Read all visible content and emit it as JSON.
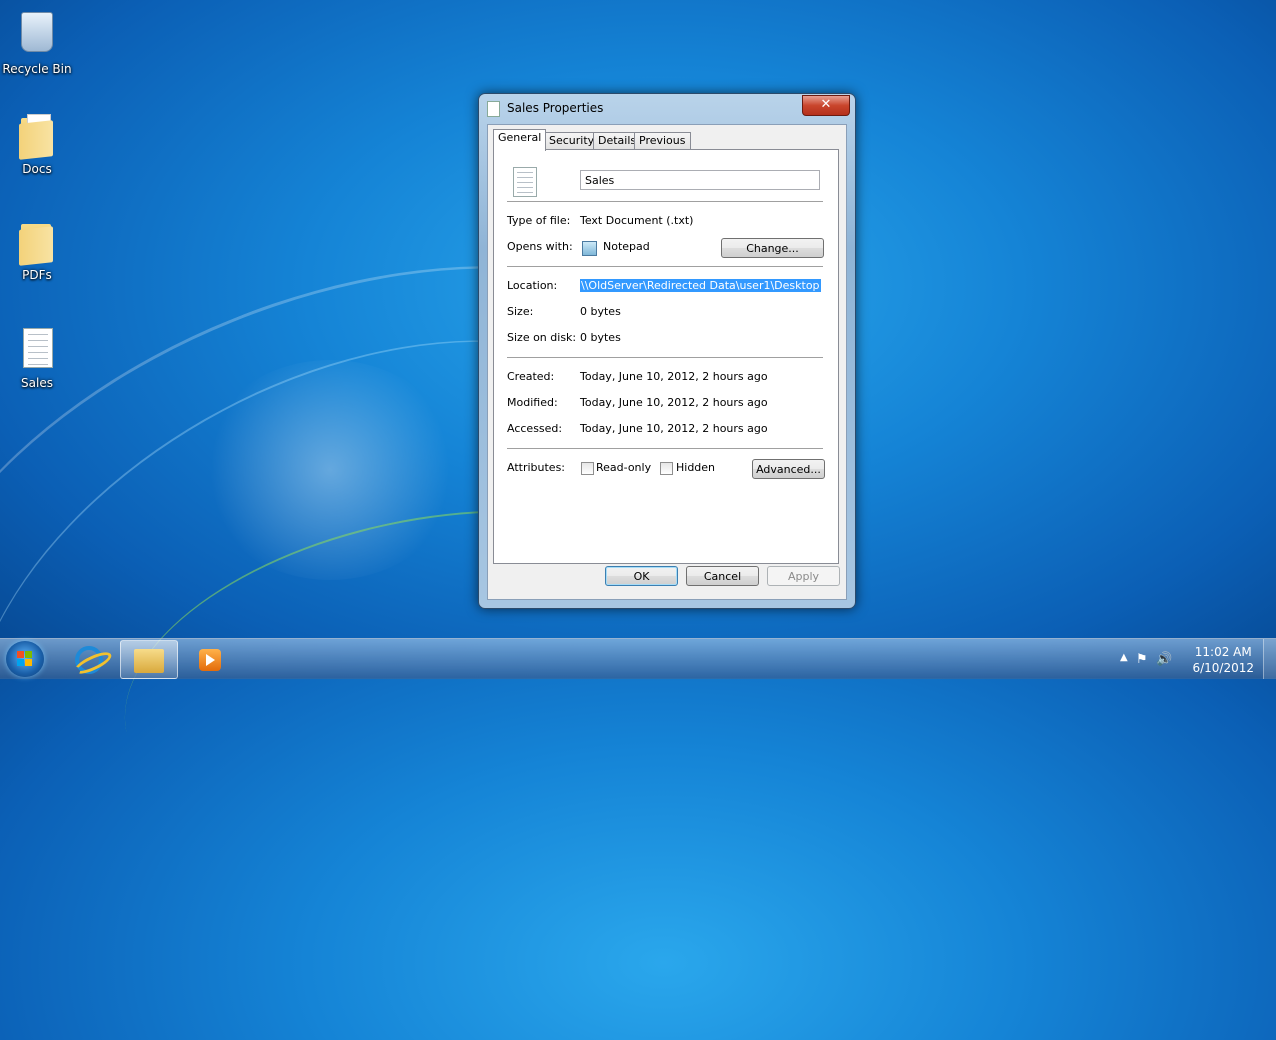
{
  "desktop": {
    "icons": [
      {
        "label": "Recycle Bin",
        "icon": "recycle-bin-icon"
      },
      {
        "label": "Docs",
        "icon": "folder-icon"
      },
      {
        "label": "PDFs",
        "icon": "folder-icon"
      },
      {
        "label": "Sales",
        "icon": "text-document-icon"
      }
    ]
  },
  "dialog": {
    "title": "Sales Properties",
    "close_label": "✕",
    "tabs": [
      "General",
      "Security",
      "Details",
      "Previous Versions"
    ],
    "active_tab": "General",
    "file_name": "Sales",
    "type_label": "Type of file:",
    "type_value": "Text Document (.txt)",
    "opens_label": "Opens with:",
    "opens_value": "Notepad",
    "change_button": "Change...",
    "location_label": "Location:",
    "location_value": "\\\\OldServer\\Redirected Data\\user1\\Desktop",
    "size_label": "Size:",
    "size_value": "0 bytes",
    "size_disk_label": "Size on disk:",
    "size_disk_value": "0 bytes",
    "created_label": "Created:",
    "created_value": "Today, June 10, 2012, 2 hours ago",
    "modified_label": "Modified:",
    "modified_value": "Today, June 10, 2012, 2 hours ago",
    "accessed_label": "Accessed:",
    "accessed_value": "Today, June 10, 2012, 2 hours ago",
    "attributes_label": "Attributes:",
    "readonly_label": "Read-only",
    "readonly_checked": false,
    "hidden_label": "Hidden",
    "hidden_checked": false,
    "advanced_button": "Advanced...",
    "ok_button": "OK",
    "cancel_button": "Cancel",
    "apply_button": "Apply"
  },
  "taskbar": {
    "pinned": [
      "internet-explorer-icon",
      "windows-explorer-icon",
      "media-player-icon"
    ],
    "tray_arrow": "▲",
    "time": "11:02 AM",
    "date": "6/10/2012"
  },
  "colors": {
    "selection": "#3399ff",
    "start_orb": "#1a5fa8"
  }
}
